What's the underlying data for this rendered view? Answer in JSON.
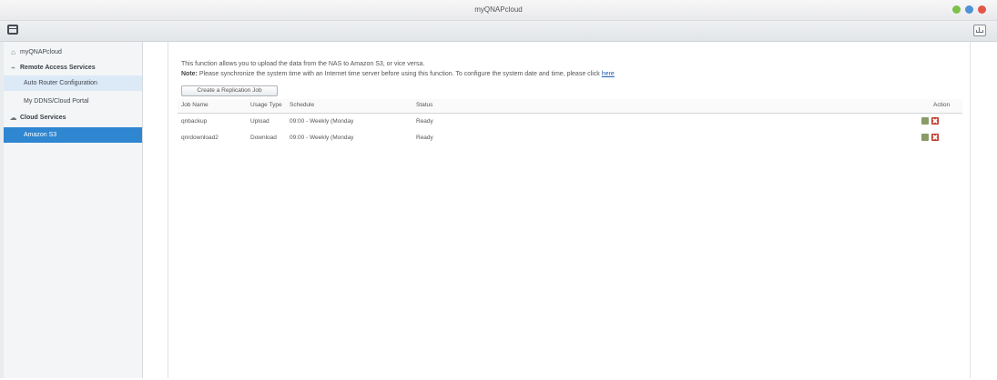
{
  "window": {
    "title": "myQNAPcloud"
  },
  "toolbar": {
    "app_icon": "app-window-icon",
    "export_icon": "export-icon"
  },
  "sidebar": {
    "items": [
      {
        "label": "myQNAPcloud",
        "icon": "home-icon"
      },
      {
        "label": "Remote Access Services",
        "icon": "remote-icon"
      },
      {
        "label": "Auto Router Configuration",
        "icon": ""
      },
      {
        "label": "My DDNS/Cloud Portal",
        "icon": ""
      },
      {
        "label": "Cloud Services",
        "icon": "cloud-icon"
      },
      {
        "label": "Amazon S3",
        "icon": ""
      }
    ]
  },
  "main": {
    "description": "This function allows you to upload the data from the NAS to Amazon S3, or vice versa.",
    "note_label": "Note:",
    "note_text": "Please synchronize the system time with an Internet time server before using this function. To configure the system date and time, please click",
    "note_link": "here",
    "create_button": "Create a Replication Job",
    "columns": [
      "Job Name",
      "Usage Type",
      "Schedule",
      "Status",
      "Action"
    ],
    "rows": [
      {
        "job_name": "qnbackup",
        "usage_type": "Upload",
        "schedule": "09:00 - Weekly (Monday",
        "status": "Ready"
      },
      {
        "job_name": "qnrdownload2",
        "usage_type": "Download",
        "schedule": "09:00 - Weekly (Monday",
        "status": "Ready"
      }
    ]
  }
}
